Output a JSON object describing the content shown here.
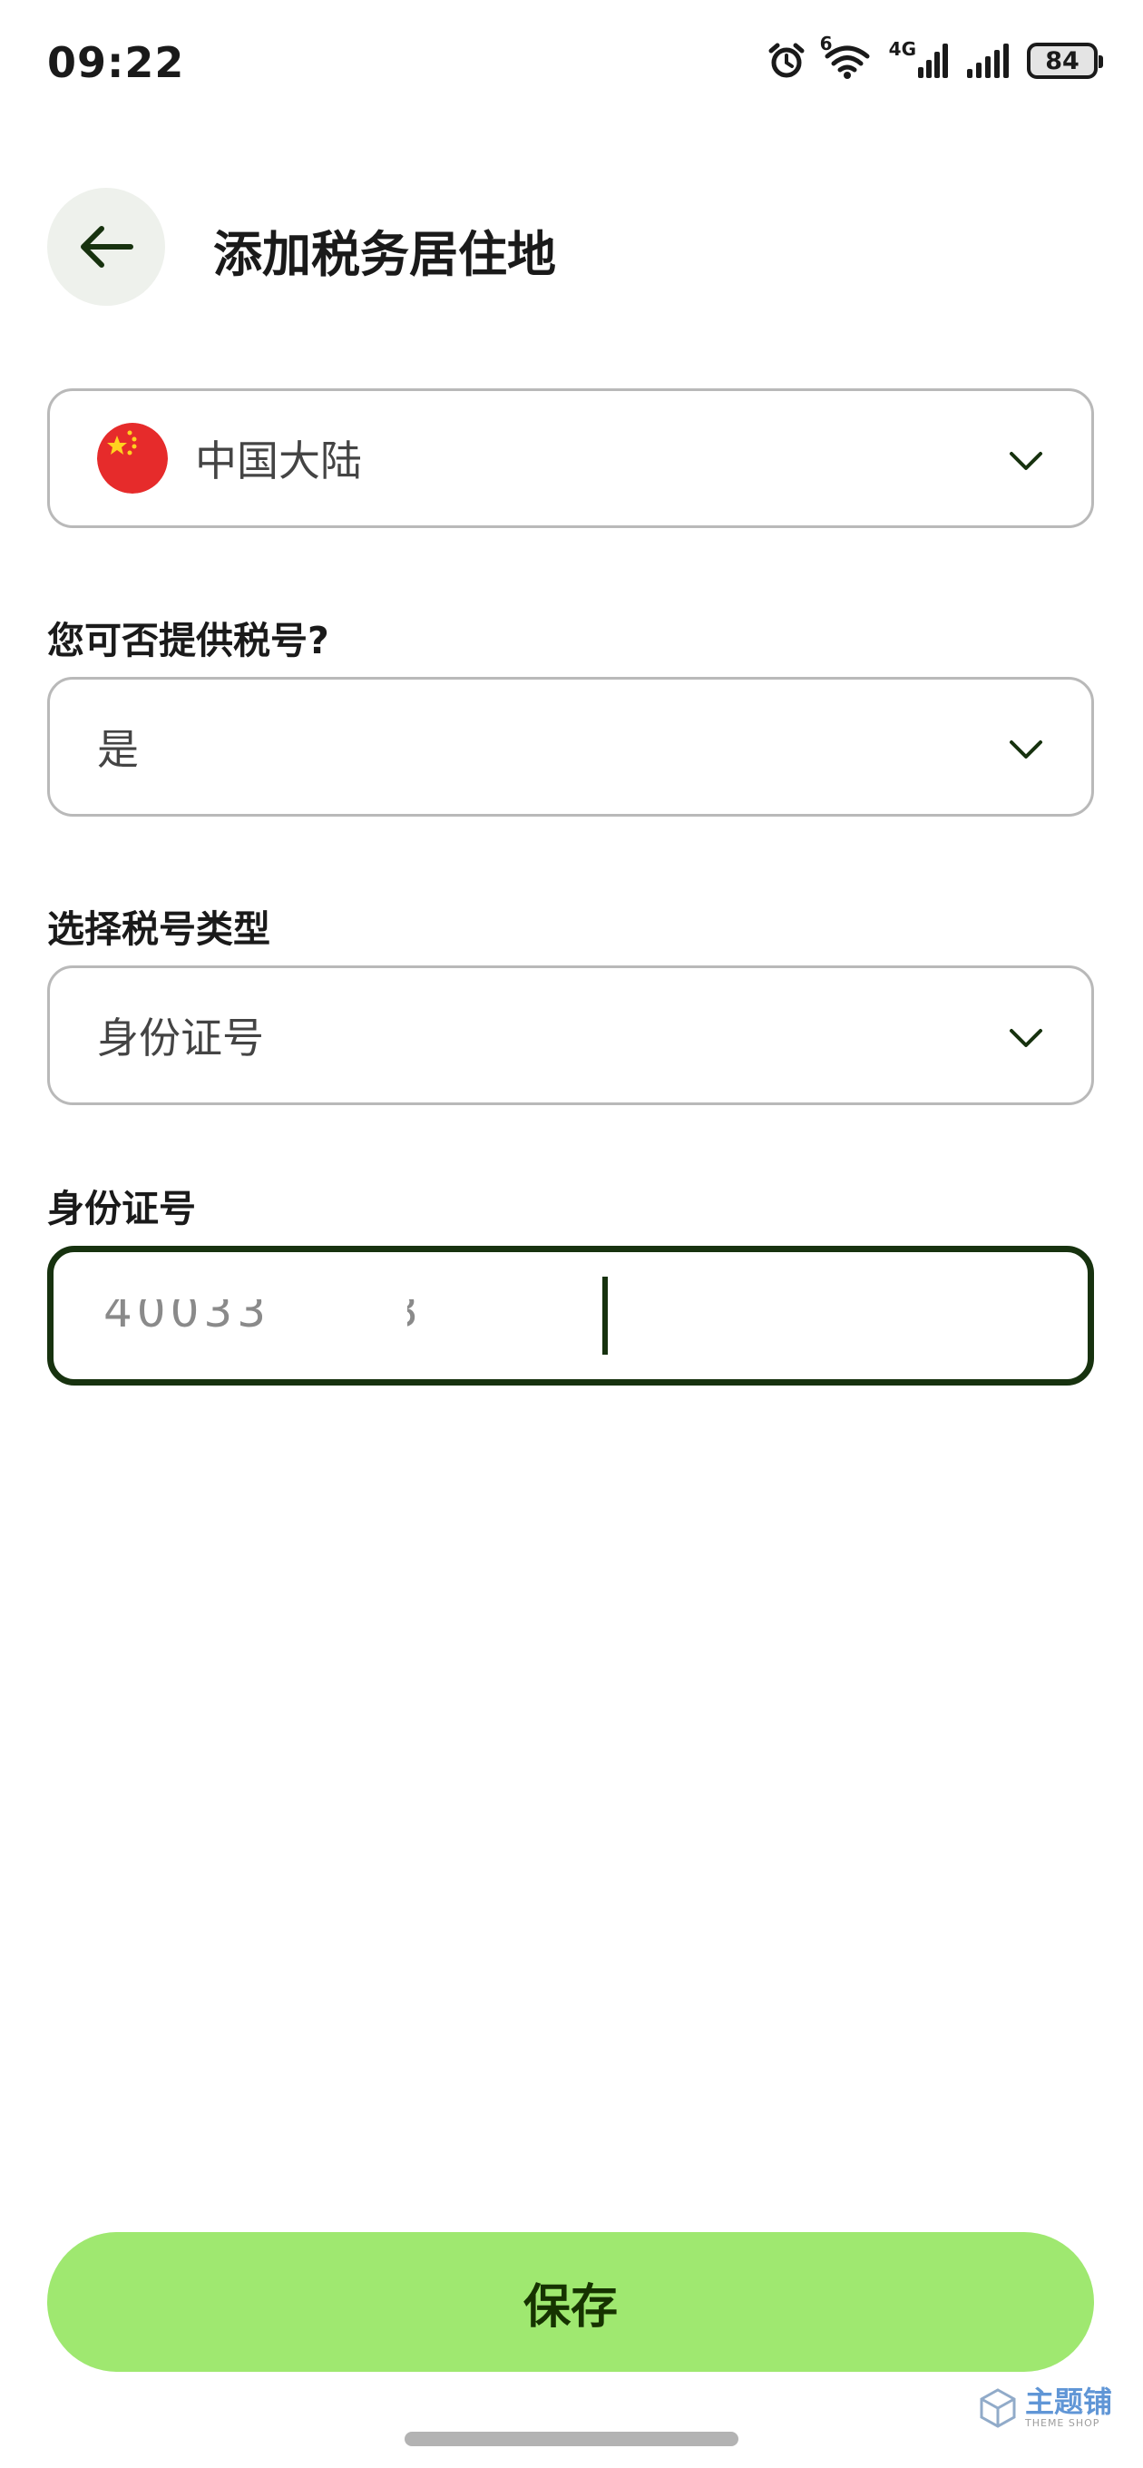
{
  "status_bar": {
    "time": "09:22",
    "icons": [
      "alarm-icon",
      "wifi-icon",
      "cellular-4g-icon",
      "cellular-icon",
      "battery-icon"
    ],
    "network_label": "4G",
    "wifi_label": "6",
    "battery_level": "84"
  },
  "header": {
    "back_icon": "arrow-left-icon",
    "title": "添加税务居住地"
  },
  "form": {
    "country": {
      "flag_icon": "china-flag-icon",
      "value": "中国大陆"
    },
    "tax_number_question": {
      "label": "您可否提供税号?",
      "value": "是"
    },
    "tax_number_type": {
      "label": "选择税号类型",
      "value": "身份证号"
    },
    "id_number": {
      "label": "身份证号",
      "value": "400332  083"
    }
  },
  "save_button": {
    "label": "保存"
  },
  "watermark": {
    "main": "主题铺",
    "sub": "THEME SHOP"
  },
  "colors": {
    "accent": "#9fe870",
    "accent_text": "#163300",
    "focus_border": "#17320f",
    "border": "#b9b9b9"
  }
}
